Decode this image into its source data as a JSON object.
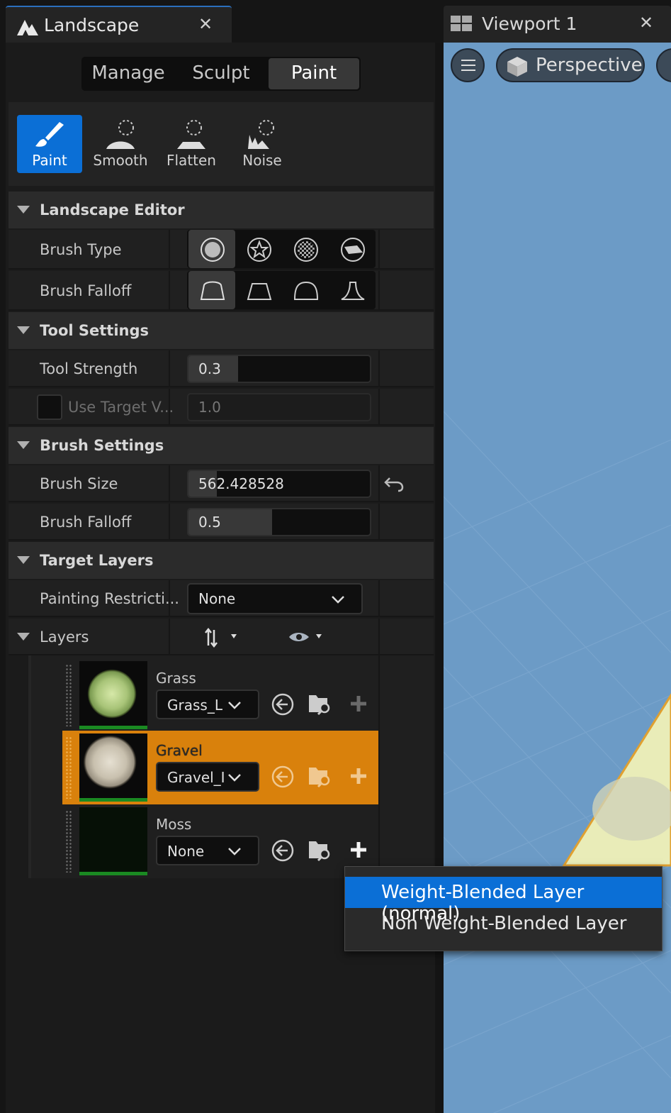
{
  "left_panel": {
    "tab_title": "Landscape",
    "close_glyph": "✕",
    "modes": [
      {
        "label": "Manage",
        "active": false
      },
      {
        "label": "Sculpt",
        "active": false
      },
      {
        "label": "Paint",
        "active": true
      }
    ],
    "tools": [
      {
        "label": "Paint",
        "icon": "paint-brush-icon",
        "active": true
      },
      {
        "label": "Smooth",
        "icon": "smooth-icon",
        "active": false
      },
      {
        "label": "Flatten",
        "icon": "flatten-icon",
        "active": false
      },
      {
        "label": "Noise",
        "icon": "noise-icon",
        "active": false
      }
    ]
  },
  "sections": {
    "landscape_editor": "Landscape Editor",
    "tool_settings": "Tool Settings",
    "brush_settings": "Brush Settings",
    "target_layers": "Target Layers"
  },
  "landscape_editor": {
    "brush_type_label": "Brush Type",
    "brush_falloff_label": "Brush Falloff"
  },
  "tool_settings": {
    "tool_strength_label": "Tool Strength",
    "tool_strength_value": "0.3",
    "tool_strength_fraction": 0.3,
    "use_target_label": "Use Target V...",
    "use_target_value": "1.0",
    "use_target_checked": false
  },
  "brush_settings": {
    "brush_size_label": "Brush Size",
    "brush_size_value": "562.428528",
    "brush_falloff_label": "Brush Falloff",
    "brush_falloff_value": "0.5",
    "brush_falloff_fraction": 0.5
  },
  "target_layers": {
    "painting_restriction_label": "Painting Restricti...",
    "painting_restriction_value": "None",
    "layers_label": "Layers",
    "layers": [
      {
        "name": "Grass",
        "asset": "Grass_L",
        "selected": false
      },
      {
        "name": "Gravel",
        "asset": "Gravel_I",
        "selected": true
      },
      {
        "name": "Moss",
        "asset": "None",
        "selected": false
      }
    ]
  },
  "viewport": {
    "tab_title": "Viewport 1",
    "close_glyph": "✕",
    "view_mode": "Perspective"
  },
  "dropdown_menu": {
    "items": [
      {
        "label": "Weight-Blended Layer (normal)",
        "highlighted": true
      },
      {
        "label": "Non Weight-Blended Layer",
        "highlighted": false
      }
    ]
  },
  "colors": {
    "accent_blue": "#0b6fd6",
    "selected_layer_orange": "#d9810c",
    "viewport_sky": "#6c9bc6"
  }
}
